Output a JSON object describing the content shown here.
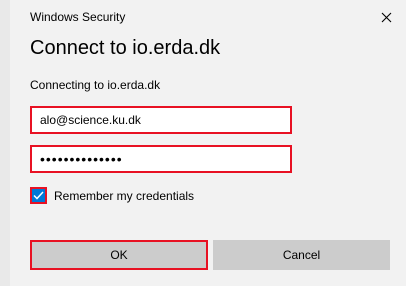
{
  "window": {
    "app_title": "Windows Security",
    "heading": "Connect to io.erda.dk",
    "connecting_text": "Connecting to io.erda.dk"
  },
  "form": {
    "username_value": "alo@science.ku.dk",
    "password_value": "••••••••••••••",
    "remember_label": "Remember my credentials",
    "remember_checked": true
  },
  "buttons": {
    "ok_label": "OK",
    "cancel_label": "Cancel"
  },
  "colors": {
    "highlight": "#e81123",
    "checkbox_fill": "#0078d7",
    "button_fill": "#cccccc",
    "dialog_bg": "#f2f2f2"
  },
  "icons": {
    "close": "close-icon",
    "checkmark": "checkmark-icon"
  }
}
